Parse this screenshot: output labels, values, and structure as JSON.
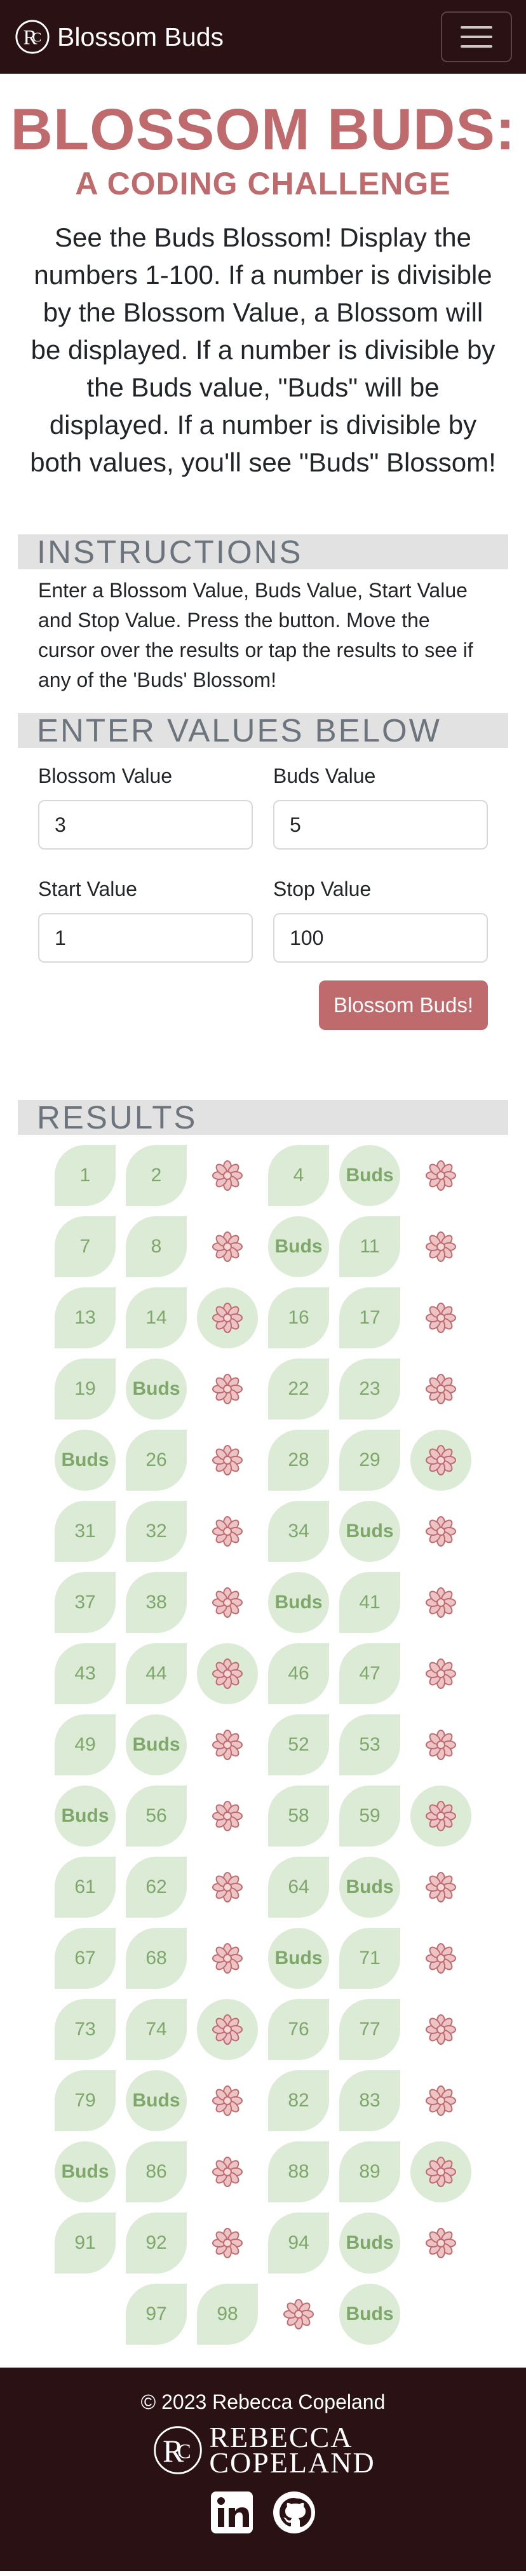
{
  "nav": {
    "brand": "Blossom Buds",
    "brand_logo_letters": "RC",
    "menu_icon": "hamburger-icon"
  },
  "header": {
    "title": "BLOSSOM BUDS:",
    "subtitle": "A CODING CHALLENGE",
    "intro": "See the Buds Blossom! Display the numbers 1-100. If a number is divisible by the Blossom Value, a Blossom will be displayed. If a number is divisible by the Buds value, \"Buds\" will be displayed. If a number is divisible by both values, you'll see \"Buds\" Blossom!"
  },
  "instructions": {
    "heading": "INSTRUCTIONS",
    "text": "Enter a Blossom Value, Buds Value, Start Value and Stop Value. Press the button. Move the cursor over the results or tap the results to see if any of the 'Buds' Blossom!"
  },
  "form": {
    "heading": "ENTER VALUES BELOW",
    "blossom_label": "Blossom Value",
    "blossom_value": "3",
    "buds_label": "Buds Value",
    "buds_value": "5",
    "start_label": "Start Value",
    "start_value": "1",
    "stop_label": "Stop Value",
    "stop_value": "100",
    "button": "Blossom Buds!"
  },
  "results": {
    "heading": "RESULTS",
    "buds_text": "Buds",
    "items": [
      {
        "t": "num",
        "v": "1"
      },
      {
        "t": "num",
        "v": "2"
      },
      {
        "t": "blossom"
      },
      {
        "t": "num",
        "v": "4"
      },
      {
        "t": "buds"
      },
      {
        "t": "blossom"
      },
      {
        "t": "num",
        "v": "7"
      },
      {
        "t": "num",
        "v": "8"
      },
      {
        "t": "blossom"
      },
      {
        "t": "buds"
      },
      {
        "t": "num",
        "v": "11"
      },
      {
        "t": "blossom"
      },
      {
        "t": "num",
        "v": "13"
      },
      {
        "t": "num",
        "v": "14"
      },
      {
        "t": "both"
      },
      {
        "t": "num",
        "v": "16"
      },
      {
        "t": "num",
        "v": "17"
      },
      {
        "t": "blossom"
      },
      {
        "t": "num",
        "v": "19"
      },
      {
        "t": "buds"
      },
      {
        "t": "blossom"
      },
      {
        "t": "num",
        "v": "22"
      },
      {
        "t": "num",
        "v": "23"
      },
      {
        "t": "blossom"
      },
      {
        "t": "buds"
      },
      {
        "t": "num",
        "v": "26"
      },
      {
        "t": "blossom"
      },
      {
        "t": "num",
        "v": "28"
      },
      {
        "t": "num",
        "v": "29"
      },
      {
        "t": "both"
      },
      {
        "t": "num",
        "v": "31"
      },
      {
        "t": "num",
        "v": "32"
      },
      {
        "t": "blossom"
      },
      {
        "t": "num",
        "v": "34"
      },
      {
        "t": "buds"
      },
      {
        "t": "blossom"
      },
      {
        "t": "num",
        "v": "37"
      },
      {
        "t": "num",
        "v": "38"
      },
      {
        "t": "blossom"
      },
      {
        "t": "buds"
      },
      {
        "t": "num",
        "v": "41"
      },
      {
        "t": "blossom"
      },
      {
        "t": "num",
        "v": "43"
      },
      {
        "t": "num",
        "v": "44"
      },
      {
        "t": "both"
      },
      {
        "t": "num",
        "v": "46"
      },
      {
        "t": "num",
        "v": "47"
      },
      {
        "t": "blossom"
      },
      {
        "t": "num",
        "v": "49"
      },
      {
        "t": "buds"
      },
      {
        "t": "blossom"
      },
      {
        "t": "num",
        "v": "52"
      },
      {
        "t": "num",
        "v": "53"
      },
      {
        "t": "blossom"
      },
      {
        "t": "buds"
      },
      {
        "t": "num",
        "v": "56"
      },
      {
        "t": "blossom"
      },
      {
        "t": "num",
        "v": "58"
      },
      {
        "t": "num",
        "v": "59"
      },
      {
        "t": "both"
      },
      {
        "t": "num",
        "v": "61"
      },
      {
        "t": "num",
        "v": "62"
      },
      {
        "t": "blossom"
      },
      {
        "t": "num",
        "v": "64"
      },
      {
        "t": "buds"
      },
      {
        "t": "blossom"
      },
      {
        "t": "num",
        "v": "67"
      },
      {
        "t": "num",
        "v": "68"
      },
      {
        "t": "blossom"
      },
      {
        "t": "buds"
      },
      {
        "t": "num",
        "v": "71"
      },
      {
        "t": "blossom"
      },
      {
        "t": "num",
        "v": "73"
      },
      {
        "t": "num",
        "v": "74"
      },
      {
        "t": "both"
      },
      {
        "t": "num",
        "v": "76"
      },
      {
        "t": "num",
        "v": "77"
      },
      {
        "t": "blossom"
      },
      {
        "t": "num",
        "v": "79"
      },
      {
        "t": "buds"
      },
      {
        "t": "blossom"
      },
      {
        "t": "num",
        "v": "82"
      },
      {
        "t": "num",
        "v": "83"
      },
      {
        "t": "blossom"
      },
      {
        "t": "buds"
      },
      {
        "t": "num",
        "v": "86"
      },
      {
        "t": "blossom"
      },
      {
        "t": "num",
        "v": "88"
      },
      {
        "t": "num",
        "v": "89"
      },
      {
        "t": "both"
      },
      {
        "t": "num",
        "v": "91"
      },
      {
        "t": "num",
        "v": "92"
      },
      {
        "t": "blossom"
      },
      {
        "t": "num",
        "v": "94"
      },
      {
        "t": "buds"
      },
      {
        "t": "blossom"
      },
      {
        "t": "num",
        "v": "97"
      },
      {
        "t": "num",
        "v": "98"
      },
      {
        "t": "blossom"
      },
      {
        "t": "buds"
      }
    ]
  },
  "footer": {
    "copyright": "© 2023 Rebecca Copeland",
    "logo_line1": "REBECCA",
    "logo_line2": "COPELAND",
    "socials": [
      "linkedin-icon",
      "github-icon"
    ]
  },
  "colors": {
    "brand_dark": "#2a1214",
    "accent": "#bf6a6d",
    "result_bg": "#dcebd6",
    "result_text": "#7ea86a",
    "section_bg": "#e2e2e2"
  }
}
